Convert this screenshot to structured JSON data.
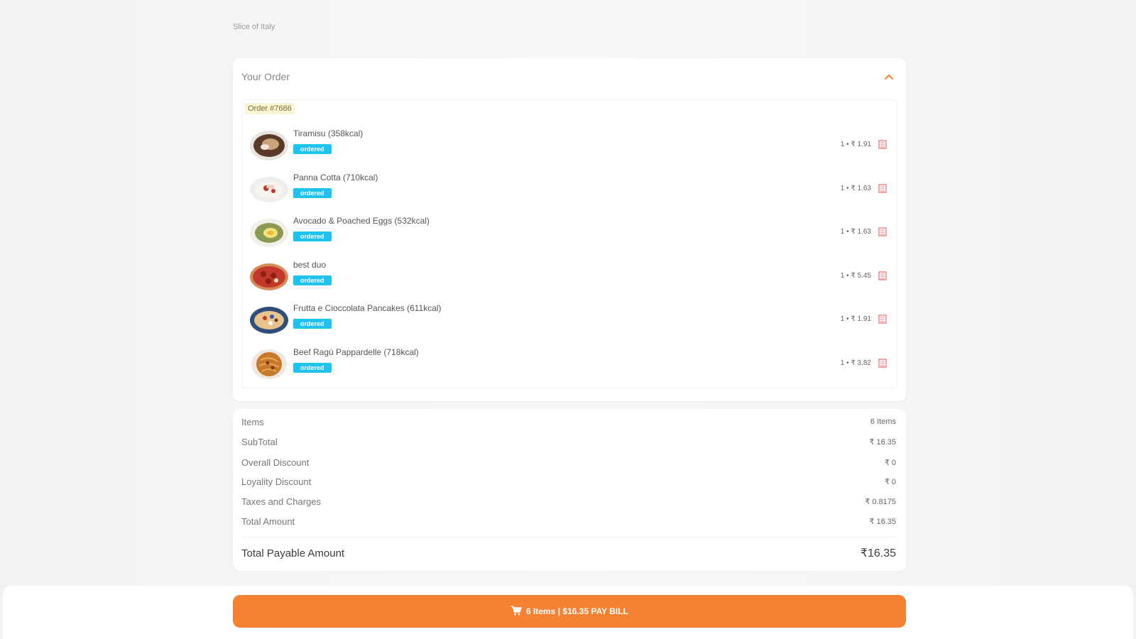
{
  "breadcrumb": "Slice of Italy",
  "order": {
    "title": "Your Order",
    "order_number": "Order #7686",
    "collapse_icon": "chevron-up-icon",
    "items": [
      {
        "name": "Tiramisu (358kcal)",
        "tag": "ordered",
        "qty_price": "1 • ₹ 1.91",
        "thumb": "tiramisu"
      },
      {
        "name": "Panna Cotta (710kcal)",
        "tag": "ordered",
        "qty_price": "1 • ₹ 1.63",
        "thumb": "panna"
      },
      {
        "name": "Avocado & Poached Eggs (532kcal)",
        "tag": "ordered",
        "qty_price": "1 • ₹ 1.63",
        "thumb": "avocado"
      },
      {
        "name": "best duo",
        "tag": "ordered",
        "qty_price": "1 • ₹ 5.45",
        "thumb": "pizza"
      },
      {
        "name": "Frutta e Cioccolata Pancakes (611kcal)",
        "tag": "ordered",
        "qty_price": "1 • ₹ 1.91",
        "thumb": "pancakes"
      },
      {
        "name": "Beef Ragù Pappardelle (718kcal)",
        "tag": "ordered",
        "qty_price": "1 • ₹ 3.82",
        "thumb": "pasta"
      }
    ]
  },
  "summary": {
    "items_label": "Items",
    "items_value": "6 Items",
    "subtotal_label": "SubTotal",
    "subtotal_value": "₹ 16.35",
    "overall_discount_label": "Overall Discount",
    "overall_discount_value": "₹ 0",
    "loyalty_discount_label": "Loyality Discount",
    "loyalty_discount_value": "₹ 0",
    "taxes_label": "Taxes and Charges",
    "taxes_value": "₹ 0.8175",
    "total_amount_label": "Total Amount",
    "total_amount_value": "₹ 16.35",
    "payable_label": "Total Payable Amount",
    "payable_value": "₹16.35"
  },
  "footer": {
    "pay_button": "6 Items | $16.35 PAY BILL",
    "cart_icon": "cart-icon"
  },
  "colors": {
    "accent": "#f58232",
    "tag": "#1ec3f0",
    "delete": "#f08080"
  }
}
